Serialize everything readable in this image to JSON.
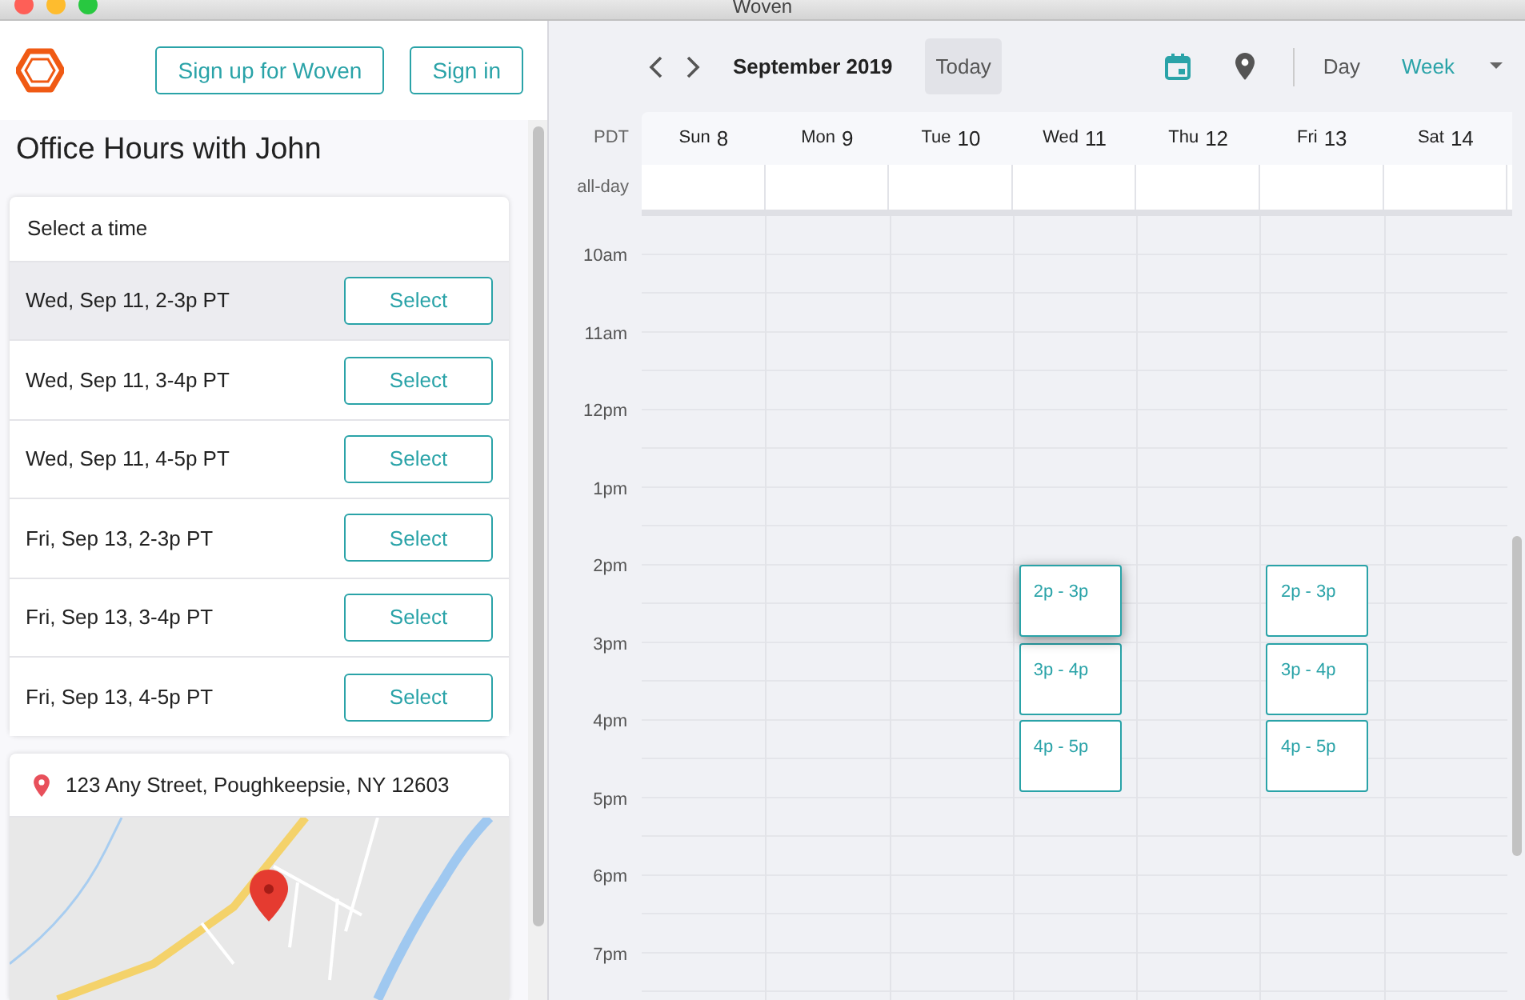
{
  "window": {
    "title": "Woven"
  },
  "header": {
    "buttons": [
      "Sign up for Woven",
      "Sign in"
    ]
  },
  "page_title": "Office Hours with John",
  "slots": {
    "heading": "Select a time",
    "items": [
      {
        "label": "Wed, Sep 11, 2-3p PT",
        "button": "Select",
        "highlighted": true
      },
      {
        "label": "Wed, Sep 11, 3-4p PT",
        "button": "Select",
        "highlighted": false
      },
      {
        "label": "Wed, Sep 11, 4-5p PT",
        "button": "Select",
        "highlighted": false
      },
      {
        "label": "Fri, Sep 13, 2-3p PT",
        "button": "Select",
        "highlighted": false
      },
      {
        "label": "Fri, Sep 13, 3-4p PT",
        "button": "Select",
        "highlighted": false
      },
      {
        "label": "Fri, Sep 13, 4-5p PT",
        "button": "Select",
        "highlighted": false
      }
    ]
  },
  "location": {
    "address": "123 Any Street, Poughkeepsie, NY 12603"
  },
  "calendar": {
    "month": "September 2019",
    "today": "Today",
    "view_icons": [
      {
        "kind": "calendar",
        "selected": true
      },
      {
        "kind": "pin",
        "selected": false
      }
    ],
    "views": [
      {
        "label": "Day",
        "selected": false
      },
      {
        "label": "Week",
        "selected": true
      }
    ],
    "timezone": "PDT",
    "all_day": "all-day",
    "hours": [
      "10am",
      "11am",
      "12pm",
      "1pm",
      "2pm",
      "3pm",
      "4pm",
      "5pm",
      "6pm",
      "7pm"
    ],
    "days": [
      {
        "weekday": "Sun",
        "date": "8"
      },
      {
        "weekday": "Mon",
        "date": "9"
      },
      {
        "weekday": "Tue",
        "date": "10"
      },
      {
        "weekday": "Wed",
        "date": "11",
        "events": [
          {
            "label": "2p - 3p",
            "highlighted": true
          },
          {
            "label": "3p - 4p",
            "highlighted": false
          },
          {
            "label": "4p - 5p",
            "highlighted": false
          }
        ]
      },
      {
        "weekday": "Thu",
        "date": "12"
      },
      {
        "weekday": "Fri",
        "date": "13",
        "events": [
          {
            "label": "2p - 3p",
            "highlighted": false
          },
          {
            "label": "3p - 4p",
            "highlighted": false
          },
          {
            "label": "4p - 5p",
            "highlighted": false
          }
        ]
      },
      {
        "weekday": "Sat",
        "date": "14"
      }
    ]
  }
}
